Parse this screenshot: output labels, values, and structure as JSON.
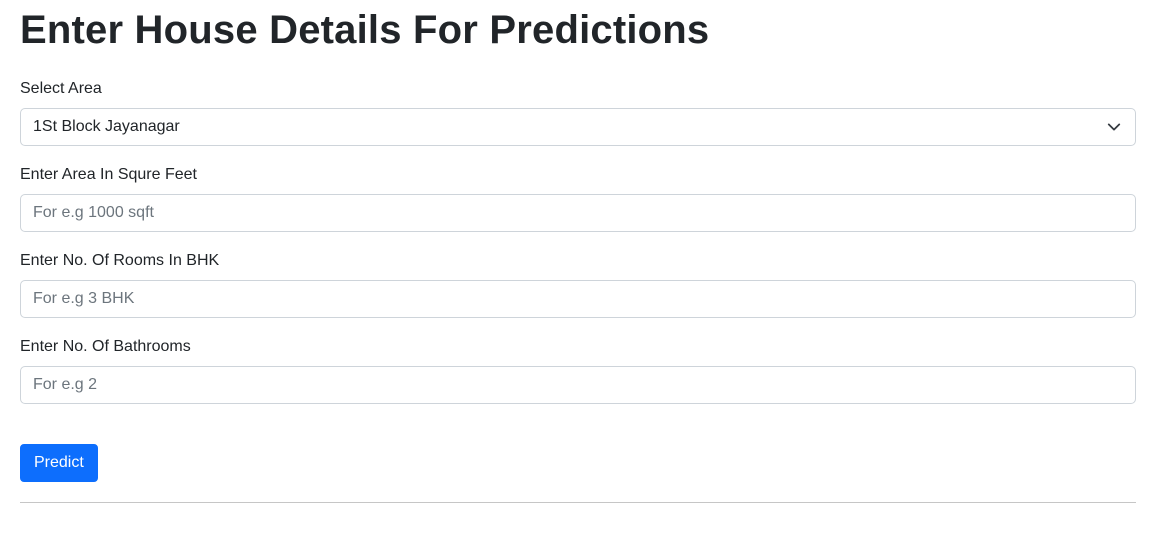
{
  "page": {
    "title": "Enter House Details For Predictions"
  },
  "form": {
    "area_select": {
      "label": "Select Area",
      "selected": "1St Block Jayanagar"
    },
    "sqft": {
      "label": "Enter Area In Squre Feet",
      "placeholder": "For e.g 1000 sqft",
      "value": ""
    },
    "bhk": {
      "label": "Enter No. Of Rooms In BHK",
      "placeholder": "For e.g 3 BHK",
      "value": ""
    },
    "bath": {
      "label": "Enter No. Of Bathrooms",
      "placeholder": "For e.g 2",
      "value": ""
    },
    "submit_label": "Predict"
  },
  "icons": {
    "select_chevron": "chevron-down-icon"
  },
  "colors": {
    "primary": "#0d6efd",
    "text": "#212529",
    "border": "#ced4da",
    "placeholder": "#6c757d"
  }
}
